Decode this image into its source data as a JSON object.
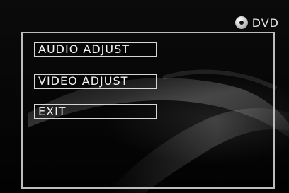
{
  "brand": {
    "label": "DVD",
    "icon": "disc-icon"
  },
  "menu": {
    "items": [
      {
        "label": "AUDIO ADJUST"
      },
      {
        "label": "VIDEO ADJUST"
      },
      {
        "label": "EXIT"
      }
    ]
  },
  "colors": {
    "background": "#050505",
    "border": "#bdbdbd",
    "text": "#f2f2f2"
  }
}
